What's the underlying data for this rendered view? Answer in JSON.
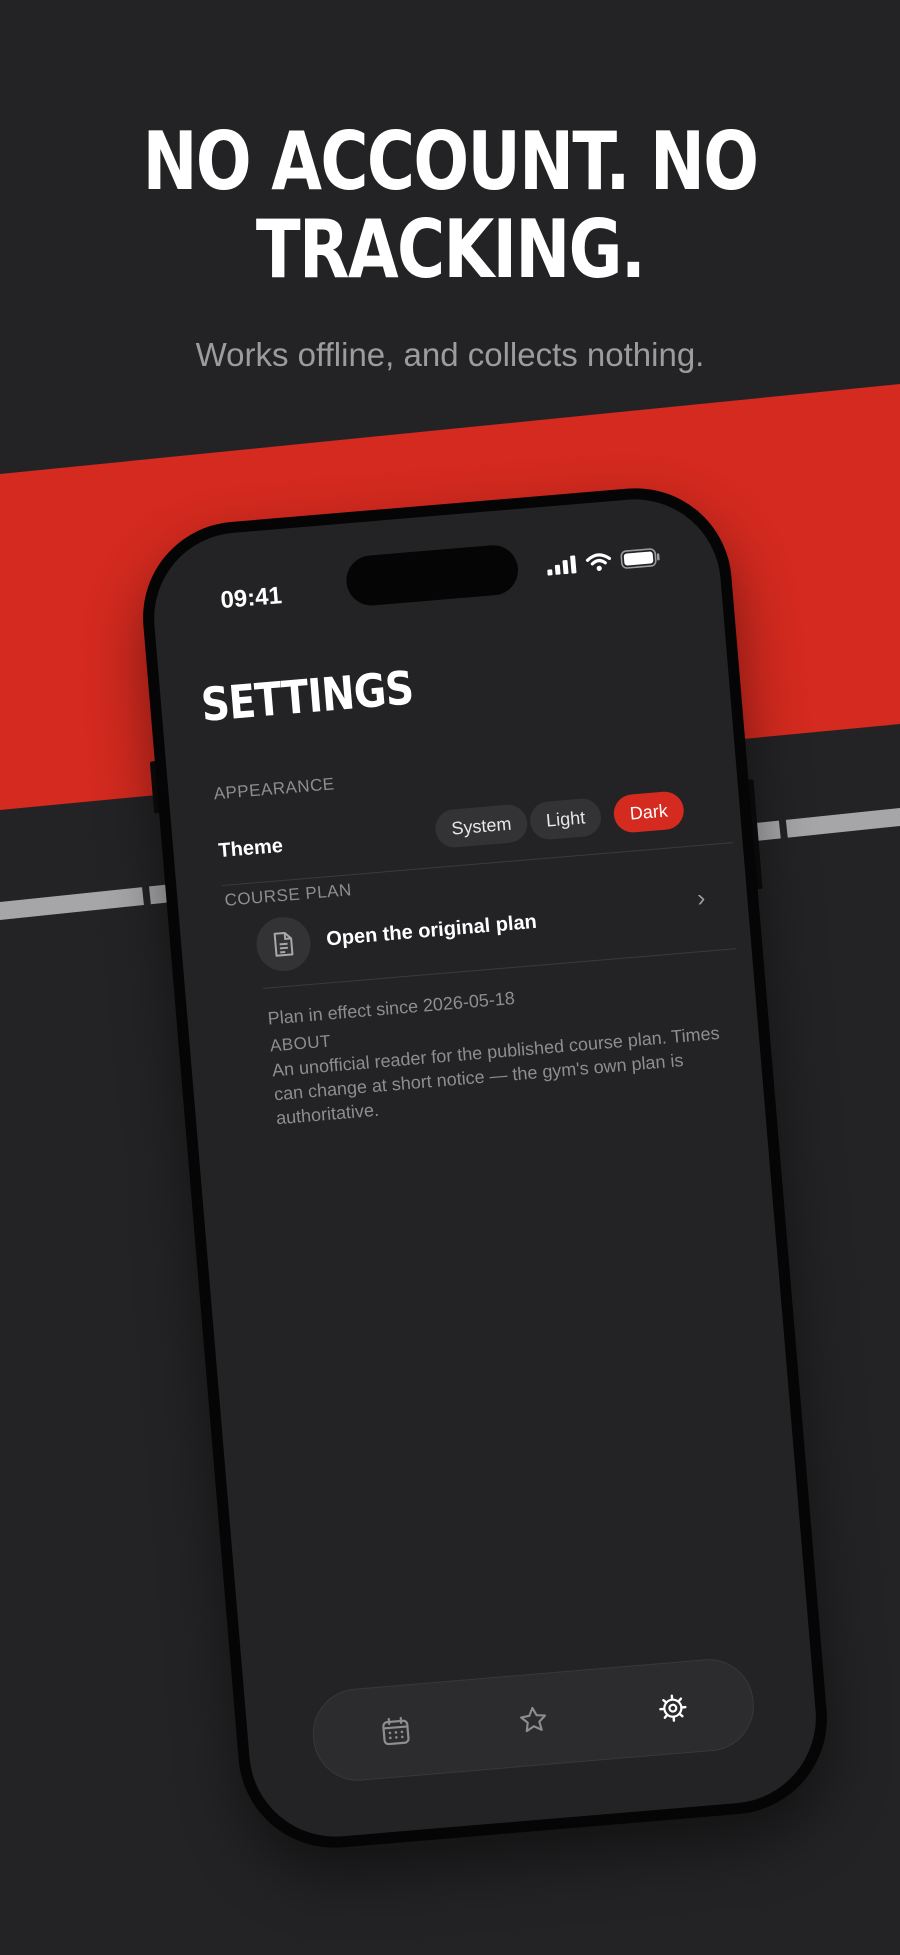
{
  "promo": {
    "headline_line1": "NO ACCOUNT. NO",
    "headline_line2": "TRACKING.",
    "subline": "Works offline, and collects nothing."
  },
  "colors": {
    "background": "#232325",
    "accent": "#d42a1f",
    "rail": "#a6a6a8"
  },
  "status_bar": {
    "time": "09:41",
    "icons": [
      "signal-icon",
      "wifi-icon",
      "battery-icon"
    ]
  },
  "settings": {
    "title": "SETTINGS",
    "appearance": {
      "section_label": "APPEARANCE",
      "theme_label": "Theme",
      "options": [
        "System",
        "Light",
        "Dark"
      ],
      "selected": "Dark"
    },
    "course_plan": {
      "section_label": "COURSE PLAN",
      "open_label": "Open the original plan",
      "effective_note": "Plan in effect since 2026-05-18"
    },
    "about": {
      "section_label": "ABOUT",
      "text": "An unofficial reader for the published course plan. Times can change at short notice — the gym's own plan is authoritative."
    }
  },
  "tab_bar": {
    "tabs": [
      "calendar-icon",
      "star-icon",
      "gear-icon"
    ],
    "active": "gear-icon"
  }
}
